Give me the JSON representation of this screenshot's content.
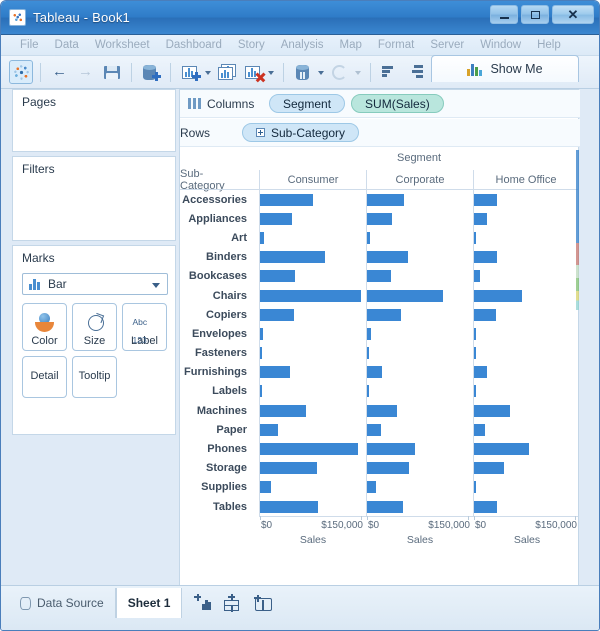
{
  "window": {
    "title": "Tableau - Book1",
    "app_icon": "tableau-logo-icon",
    "minimize": "minimize-icon",
    "maximize": "maximize-icon",
    "close": "close-icon"
  },
  "menubar": {
    "items": [
      "File",
      "Data",
      "Worksheet",
      "Dashboard",
      "Story",
      "Analysis",
      "Map",
      "Format",
      "Server",
      "Window",
      "Help"
    ]
  },
  "toolbar": {
    "buttons": [
      {
        "name": "tableau-home-icon",
        "selected": true
      },
      {
        "name": "back-arrow-icon",
        "selected": false
      },
      {
        "name": "forward-arrow-icon",
        "selected": false
      },
      {
        "name": "save-icon",
        "selected": false
      },
      {
        "name": "add-data-source-icon",
        "selected": false
      },
      {
        "name": "new-worksheet-icon",
        "selected": false
      },
      {
        "name": "duplicate-sheet-icon",
        "selected": false
      },
      {
        "name": "clear-sheet-icon",
        "selected": false
      },
      {
        "name": "pause-updates-icon",
        "selected": false
      },
      {
        "name": "refresh-icon",
        "selected": false
      },
      {
        "name": "sort-ascending-icon",
        "selected": false
      },
      {
        "name": "group-members-icon",
        "selected": false
      }
    ],
    "show_me": {
      "label": "Show Me",
      "icon": "show-me-bar-chart-icon"
    }
  },
  "left_panel": {
    "pages": {
      "title": "Pages"
    },
    "filters": {
      "title": "Filters"
    },
    "marks": {
      "title": "Marks",
      "mark_type": "Bar",
      "mark_type_icon": "bar-mark-icon",
      "buttons": [
        {
          "label": "Color",
          "icon": "color-palette-icon"
        },
        {
          "label": "Size",
          "icon": "size-circle-icon"
        },
        {
          "label": "Label",
          "icon": "abc-123-label-icon"
        },
        {
          "label": "Detail",
          "icon": "detail-icon"
        },
        {
          "label": "Tooltip",
          "icon": "tooltip-icon"
        }
      ]
    }
  },
  "shelves": {
    "columns": {
      "label": "Columns",
      "icon": "columns-shelf-icon",
      "pills": [
        {
          "label": "Segment",
          "kind": "dimension",
          "expandable": false
        },
        {
          "label": "SUM(Sales)",
          "kind": "measure",
          "expandable": false
        }
      ]
    },
    "rows": {
      "label": "Rows",
      "icon": "rows-shelf-icon",
      "pills": [
        {
          "label": "Sub-Category",
          "kind": "dimension",
          "expandable": true
        }
      ]
    }
  },
  "chart_data": {
    "type": "bar",
    "title": "Segment",
    "subtitle": "",
    "orientation": "horizontal",
    "row_field_label": "Sub-Category",
    "xlabel": "Sales",
    "ylabel": "Sub-Category",
    "xlim": [
      0,
      150000
    ],
    "tick_labels": [
      "$0",
      "$150,000"
    ],
    "tick_values": [
      0,
      150000
    ],
    "grid": false,
    "legend_position": "none",
    "bar_color": "#3a87d4",
    "panels": [
      "Consumer",
      "Corporate",
      "Home Office"
    ],
    "categories": [
      "Accessories",
      "Appliances",
      "Art",
      "Binders",
      "Bookcases",
      "Chairs",
      "Copiers",
      "Envelopes",
      "Fasteners",
      "Furnishings",
      "Labels",
      "Machines",
      "Paper",
      "Phones",
      "Storage",
      "Supplies",
      "Tables"
    ],
    "series": [
      {
        "name": "Consumer",
        "values": [
          79000,
          47000,
          6500,
          96000,
          52000,
          150000,
          51000,
          4500,
          800,
          44000,
          3400,
          68000,
          26000,
          145000,
          85000,
          16000,
          86000
        ]
      },
      {
        "name": "Corporate",
        "values": [
          55000,
          37000,
          4200,
          61000,
          36000,
          113000,
          51000,
          5200,
          900,
          23000,
          2100,
          45000,
          21000,
          72000,
          63000,
          13000,
          53000
        ]
      },
      {
        "name": "Home Office",
        "values": [
          34000,
          20000,
          2400,
          34000,
          9500,
          71000,
          32000,
          3000,
          600,
          19000,
          1500,
          54000,
          17000,
          81000,
          45000,
          900,
          34000
        ]
      }
    ]
  },
  "statusbar": {
    "data_source": {
      "label": "Data Source",
      "icon": "data-source-icon"
    },
    "sheets": [
      {
        "label": "Sheet 1",
        "active": true
      }
    ],
    "new_buttons": [
      {
        "name": "new-worksheet-icon"
      },
      {
        "name": "new-dashboard-icon"
      },
      {
        "name": "new-story-icon"
      }
    ]
  },
  "colors": {
    "accent": "#3a87d4",
    "dimension_pill": "#cfe6f7",
    "measure_pill": "#b9e6dd",
    "titlebar": "#2f7cc8"
  }
}
